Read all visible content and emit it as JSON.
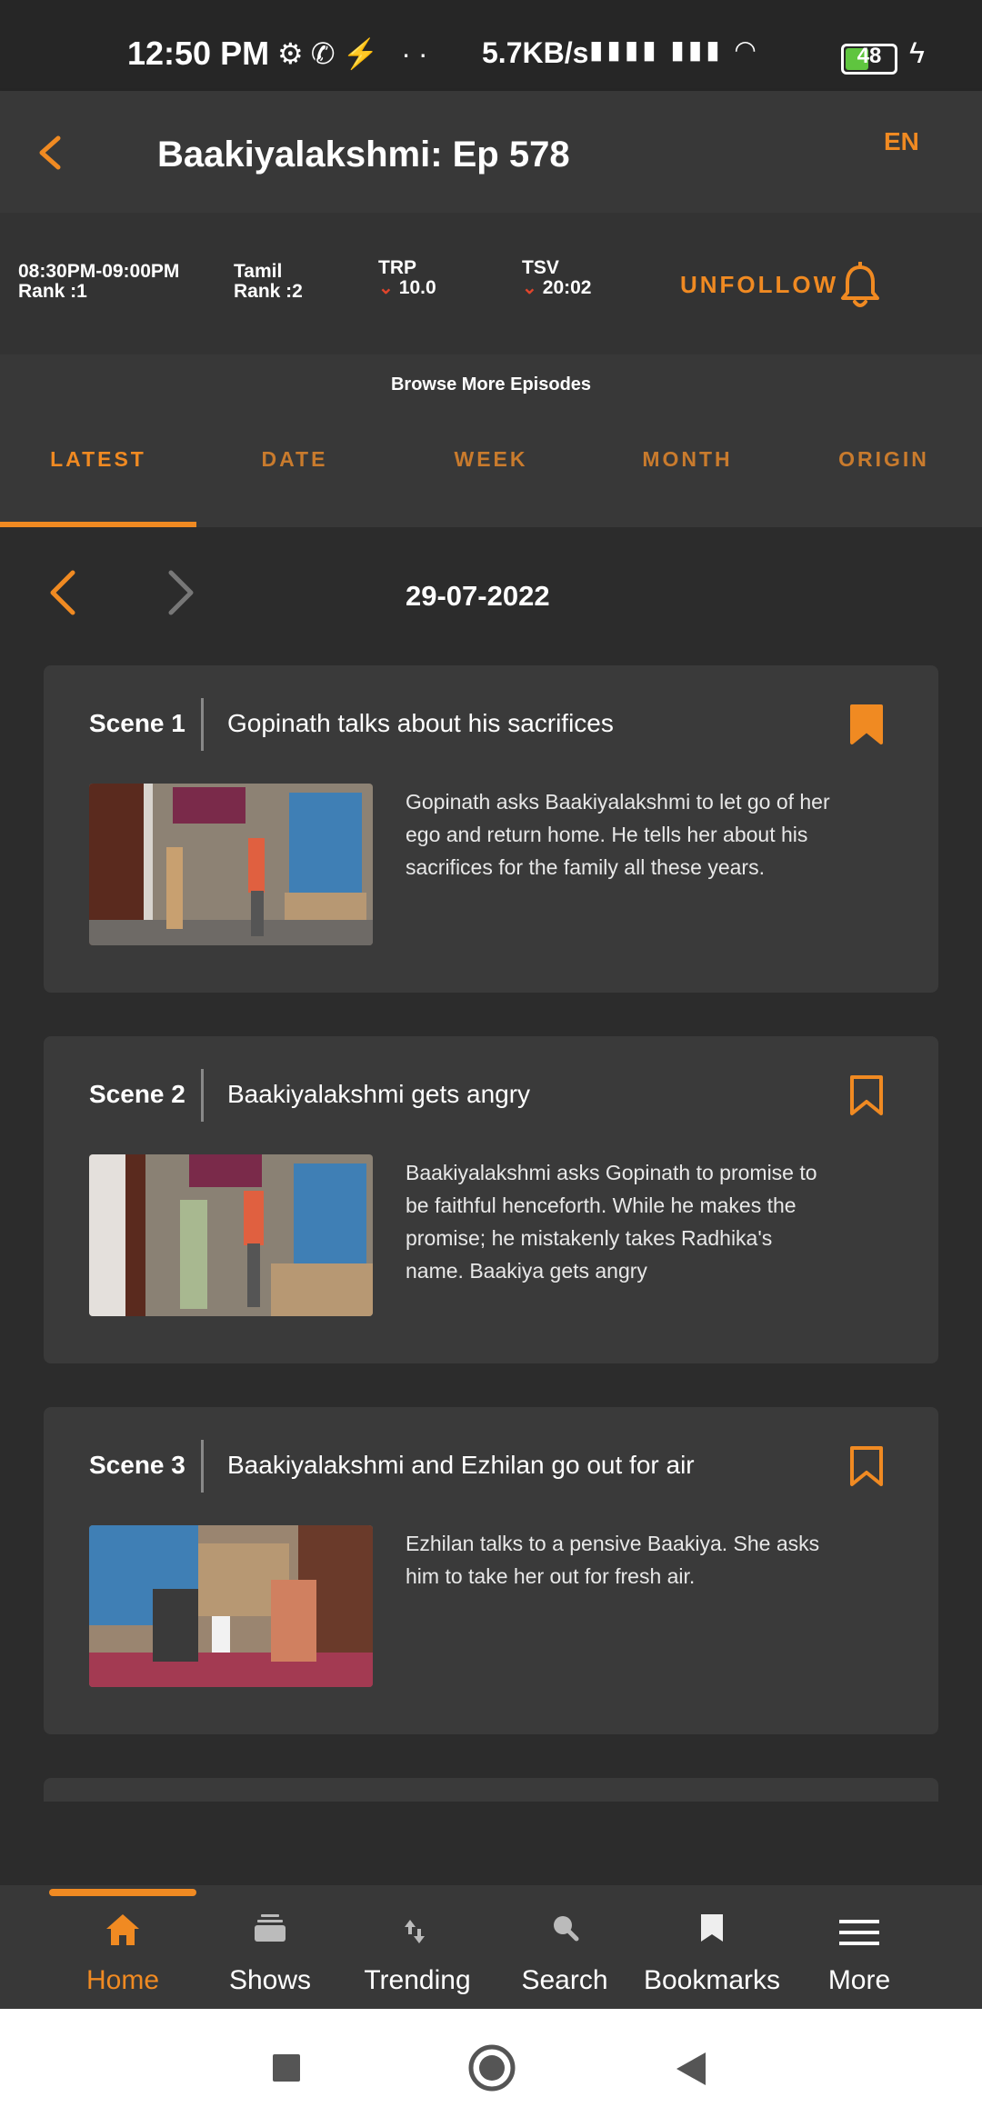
{
  "status_bar": {
    "time": "12:50 PM",
    "speed": "5.7KB/s",
    "battery": "48"
  },
  "header": {
    "title": "Baakiyalakshmi: Ep 578",
    "lang": "EN"
  },
  "info": {
    "slot": "08:30PM-09:00PM",
    "slot_rank": "Rank :1",
    "lang": "Tamil",
    "lang_rank": "Rank :2",
    "trp_label": "TRP",
    "trp_value": "10.0",
    "tsv_label": "TSV",
    "tsv_value": "20:02",
    "follow_label": "UNFOLLOW"
  },
  "browse": {
    "heading": "Browse More Episodes",
    "tabs": [
      "LATEST",
      "DATE",
      "WEEK",
      "MONTH",
      "ORIGIN"
    ],
    "active_tab": "LATEST"
  },
  "date": "29-07-2022",
  "scenes": [
    {
      "label": "Scene 1",
      "title": "Gopinath talks about his sacrifices",
      "bookmarked": true,
      "desc": "Gopinath asks Baakiyalakshmi to let go of her ego and return home. He tells her about his sacrifices for the family all these years."
    },
    {
      "label": "Scene 2",
      "title": "Baakiyalakshmi gets angry",
      "bookmarked": false,
      "desc": "Baakiyalakshmi asks Gopinath to promise to be faithful henceforth. While he makes the promise; he mistakenly takes Radhika's name. Baakiya gets angry"
    },
    {
      "label": "Scene 3",
      "title": "Baakiyalakshmi and Ezhilan go out for air",
      "bookmarked": false,
      "desc": "Ezhilan talks to a pensive Baakiya. She asks him to take her out for fresh air."
    }
  ],
  "bottom_nav": [
    {
      "label": "Home",
      "icon": "home-icon",
      "active": true
    },
    {
      "label": "Shows",
      "icon": "shows-icon",
      "active": false
    },
    {
      "label": "Trending",
      "icon": "trending-icon",
      "active": false
    },
    {
      "label": "Search",
      "icon": "search-icon",
      "active": false
    },
    {
      "label": "Bookmarks",
      "icon": "bookmarks-icon",
      "active": false
    },
    {
      "label": "More",
      "icon": "menu-icon",
      "active": false
    }
  ],
  "colors": {
    "accent": "#f08a22",
    "background": "#2c2c2c",
    "card": "#3a3a3a",
    "down_arrow": "#e0452c"
  }
}
